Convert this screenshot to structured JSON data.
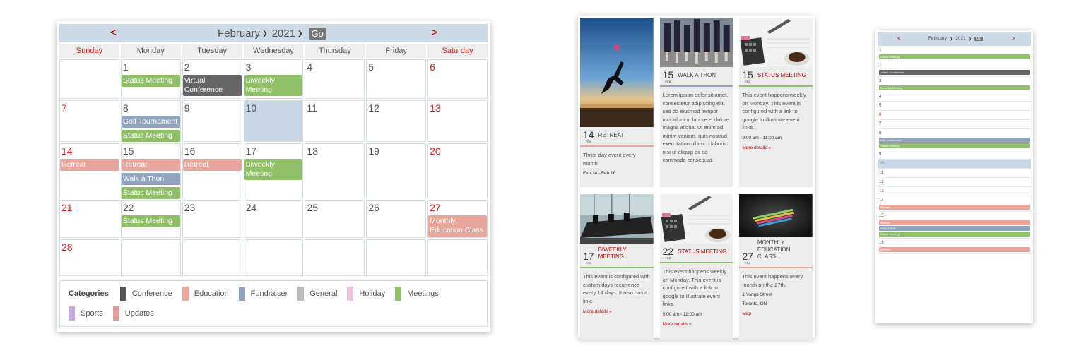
{
  "calendar": {
    "prev": "<",
    "next": ">",
    "month": "February",
    "year": "2021",
    "go": "Go",
    "days_of_week": [
      "Sunday",
      "Monday",
      "Tuesday",
      "Wednesday",
      "Thursday",
      "Friday",
      "Saturday"
    ],
    "days": [
      {
        "num": "",
        "events": []
      },
      {
        "num": "1",
        "events": [
          {
            "label": "Status Meeting",
            "cat": "meet"
          }
        ]
      },
      {
        "num": "2",
        "events": [
          {
            "label": "Virtual Conference",
            "cat": "conf"
          }
        ]
      },
      {
        "num": "3",
        "events": [
          {
            "label": "Biweekly Meeting",
            "cat": "meet"
          }
        ]
      },
      {
        "num": "4",
        "events": []
      },
      {
        "num": "5",
        "events": []
      },
      {
        "num": "6",
        "events": []
      },
      {
        "num": "7",
        "events": []
      },
      {
        "num": "8",
        "events": [
          {
            "label": "Golf Tournament",
            "cat": "fund"
          },
          {
            "label": "Status Meeting",
            "cat": "meet"
          }
        ]
      },
      {
        "num": "9",
        "events": []
      },
      {
        "num": "10",
        "events": [],
        "today": true
      },
      {
        "num": "11",
        "events": []
      },
      {
        "num": "12",
        "events": []
      },
      {
        "num": "13",
        "events": []
      },
      {
        "num": "14",
        "events": [
          {
            "label": "Retreat",
            "cat": "edu"
          }
        ]
      },
      {
        "num": "15",
        "events": [
          {
            "label": "Retreat",
            "cat": "edu"
          },
          {
            "label": "Walk a Thon",
            "cat": "fund"
          },
          {
            "label": "Status Meeting",
            "cat": "meet"
          }
        ]
      },
      {
        "num": "16",
        "events": [
          {
            "label": "Retreat",
            "cat": "edu"
          }
        ]
      },
      {
        "num": "17",
        "events": [
          {
            "label": "Biweekly Meeting",
            "cat": "meet"
          }
        ]
      },
      {
        "num": "18",
        "events": []
      },
      {
        "num": "19",
        "events": []
      },
      {
        "num": "20",
        "events": []
      },
      {
        "num": "21",
        "events": []
      },
      {
        "num": "22",
        "events": [
          {
            "label": "Status Meeting",
            "cat": "meet"
          }
        ]
      },
      {
        "num": "23",
        "events": []
      },
      {
        "num": "24",
        "events": []
      },
      {
        "num": "25",
        "events": []
      },
      {
        "num": "26",
        "events": []
      },
      {
        "num": "27",
        "events": [
          {
            "label": "Monthly Education Class",
            "cat": "edu"
          }
        ]
      },
      {
        "num": "28",
        "events": []
      },
      {
        "num": "",
        "events": []
      },
      {
        "num": "",
        "events": []
      },
      {
        "num": "",
        "events": []
      },
      {
        "num": "",
        "events": []
      },
      {
        "num": "",
        "events": []
      },
      {
        "num": "",
        "events": []
      }
    ],
    "legend": {
      "title": "Categories",
      "items": [
        {
          "label": "Conference",
          "color": "#555555"
        },
        {
          "label": "Education",
          "color": "#e8a79a"
        },
        {
          "label": "Fundraiser",
          "color": "#90a4bd"
        },
        {
          "label": "General",
          "color": "#bbbbbb"
        },
        {
          "label": "Holiday",
          "color": "#f0c0e0"
        },
        {
          "label": "Meetings",
          "color": "#8fbf67"
        },
        {
          "label": "Sports",
          "color": "#c8a8e0"
        },
        {
          "label": "Updates",
          "color": "#e0a0a0"
        }
      ]
    }
  },
  "cards": [
    {
      "image": "beach-jump-photo",
      "day": "14",
      "mon": "FEB",
      "title": "RETREAT",
      "red": false,
      "cat": "edu",
      "body": "Three day event every month",
      "meta": [
        "Feb 14 - Feb 16"
      ],
      "more": ""
    },
    {
      "image": "marathon-runners-photo",
      "day": "15",
      "mon": "FEB",
      "title": "WALK A THON",
      "red": false,
      "cat": "fund",
      "body": "Lorem ipsum dolor sit amet, consectetur adipiscing elit, sed do eiusmod tempor incididunt ut labore et dolore magna aliqua. Ut enim ad minim veniam, quis nostrud exercitation ullamco laboris nisi ut aliquip ex ea commodo consequat.",
      "meta": [],
      "more": ""
    },
    {
      "image": "calculator-desk-photo",
      "day": "15",
      "mon": "FEB",
      "title": "STATUS MEETING",
      "red": true,
      "cat": "meet",
      "body": "This event happens weekly on Monday. This event is configured with a link to google to illustrate event links.",
      "meta": [
        "9:00 am - 11:00 am"
      ],
      "more": "More details »"
    },
    {
      "image": "conference-room-photo",
      "day": "17",
      "mon": "FEB",
      "title": "BIWEEKLY MEETING",
      "red": true,
      "cat": "meet",
      "body": "This event is configured with custom days recurrence every 14 days. It also has a link.",
      "meta": [],
      "more": "More details »"
    },
    {
      "image": "calculator-desk-photo",
      "day": "22",
      "mon": "FEB",
      "title": "STATUS MEETING",
      "red": true,
      "cat": "meet",
      "body": "This event happens weekly on Monday. This event is configured with a link to google to illustrate event links.",
      "meta": [
        "9:00 am - 11:00 am"
      ],
      "more": "More details »"
    },
    {
      "image": "pencils-photo",
      "day": "27",
      "mon": "FEB",
      "title": "MONTHLY EDUCATION CLASS",
      "red": false,
      "cat": "edu",
      "body": "This event happens every month on the 27th.",
      "meta": [
        "1 Yonge Street",
        "Toronto, ON"
      ],
      "more": "Map"
    }
  ],
  "mobile": {
    "prev": "<",
    "next": ">",
    "month": "February",
    "year": "2021",
    "go": "Go",
    "rows": [
      {
        "num": "1",
        "events": [
          {
            "label": "Status Meeting",
            "cat": "meet"
          }
        ]
      },
      {
        "num": "2",
        "events": [
          {
            "label": "Virtual Conference",
            "cat": "conf"
          }
        ]
      },
      {
        "num": "3",
        "events": [
          {
            "label": "Biweekly Meeting",
            "cat": "meet"
          }
        ]
      },
      {
        "num": "4",
        "events": []
      },
      {
        "num": "5",
        "events": []
      },
      {
        "num": "6",
        "events": [],
        "weekend": true
      },
      {
        "num": "7",
        "events": [],
        "weekend": true
      },
      {
        "num": "8",
        "events": [
          {
            "label": "Golf Tournament",
            "cat": "fund"
          },
          {
            "label": "Status Meeting",
            "cat": "meet"
          }
        ]
      },
      {
        "num": "9",
        "events": []
      },
      {
        "num": "10",
        "events": [],
        "today": true
      },
      {
        "num": "11",
        "events": []
      },
      {
        "num": "12",
        "events": []
      },
      {
        "num": "13",
        "events": [],
        "weekend": true
      },
      {
        "num": "14",
        "events": [
          {
            "label": "Retreat",
            "cat": "edu"
          }
        ],
        "weekend": true
      },
      {
        "num": "15",
        "events": [
          {
            "label": "Retreat",
            "cat": "edu"
          },
          {
            "label": "Walk a Thon",
            "cat": "fund"
          },
          {
            "label": "Status Meeting",
            "cat": "meet"
          }
        ]
      },
      {
        "num": "16",
        "events": [
          {
            "label": "Retreat",
            "cat": "edu"
          }
        ]
      }
    ]
  }
}
